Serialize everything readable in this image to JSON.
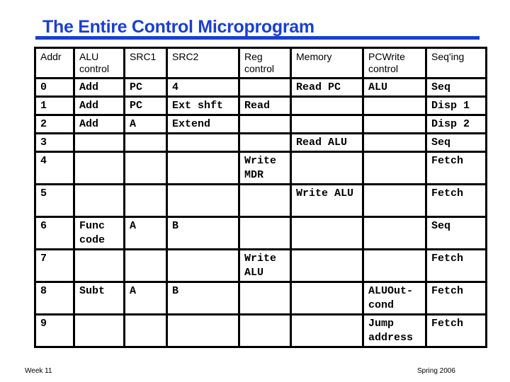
{
  "title": "The Entire Control Microprogram",
  "table": {
    "headers": [
      "Addr",
      "ALU control",
      "SRC1",
      "SRC2",
      "Reg control",
      "Memory",
      "PCWrite control",
      "Seq'ing"
    ],
    "rows": [
      [
        "0",
        "Add",
        "PC",
        "4",
        "",
        "Read PC",
        "ALU",
        "Seq"
      ],
      [
        "1",
        "Add",
        "PC",
        "Ext shft",
        "Read",
        "",
        "",
        "Disp 1"
      ],
      [
        "2",
        "Add",
        "A",
        "Extend",
        "",
        "",
        "",
        "Disp 2"
      ],
      [
        "3",
        "",
        "",
        "",
        "",
        "Read ALU",
        "",
        "Seq"
      ],
      [
        "4",
        "",
        "",
        "",
        "Write MDR",
        "",
        "",
        "Fetch"
      ],
      [
        "5",
        "",
        "",
        "",
        "",
        "Write ALU",
        "",
        "Fetch"
      ],
      [
        "6",
        "Func code",
        "A",
        "B",
        "",
        "",
        "",
        "Seq"
      ],
      [
        "7",
        "",
        "",
        "",
        "Write ALU",
        "",
        "",
        "Fetch"
      ],
      [
        "8",
        "Subt",
        "A",
        "B",
        "",
        "",
        "ALUOut-cond",
        "Fetch"
      ],
      [
        "9",
        "",
        "",
        "",
        "",
        "",
        "Jump address",
        "Fetch"
      ]
    ]
  },
  "footer": {
    "left": "Week 11",
    "right": "Spring 2006"
  }
}
